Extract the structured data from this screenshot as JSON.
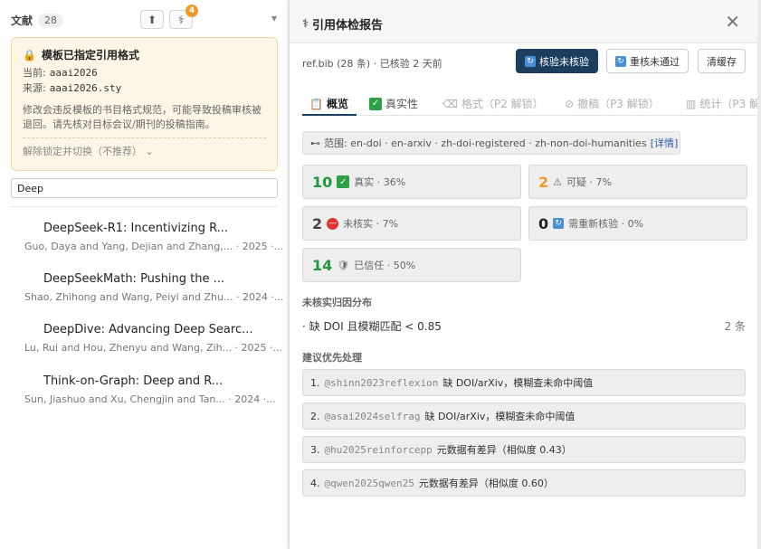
{
  "sidebar": {
    "title": "文献",
    "count": "28",
    "badge": "4",
    "lock_card": {
      "title": "模板已指定引用格式",
      "current_label": "当前:",
      "current_value": "aaai2026",
      "source_label": "来源:",
      "source_value": "aaai2026.sty",
      "description": "修改会违反模板的书目格式规范，可能导致投稿审核被退回。请先核对目标会议/期刊的投稿指南。",
      "unlock_label": "解除锁定并切换（不推荐）"
    },
    "search": {
      "value": "Deep"
    },
    "entries": [
      {
        "title": "DeepSeek-R1: Incentivizing R...",
        "meta": "Guo, Daya and Yang, Dejian and Zhang,... · 2025 ·..."
      },
      {
        "title": "DeepSeekMath: Pushing the ...",
        "meta": "Shao, Zhihong and Wang, Peiyi and Zhu... · 2024 ·..."
      },
      {
        "title": "DeepDive: Advancing Deep Searc...",
        "meta": "Lu, Rui and Hou, Zhenyu and Wang, Zih... · 2025 ·..."
      },
      {
        "title": "Think-on-Graph: Deep and R...",
        "meta": "Sun, Jiashuo and Xu, Chengjin and Tan... · 2024 ·..."
      }
    ]
  },
  "report": {
    "title": "引用体检报告",
    "file_info": "ref.bib (28 条) · 已核验 2 天前",
    "buttons": {
      "verify": "核验未核验",
      "recheck": "重核未通过",
      "clear": "清缓存"
    },
    "tabs": [
      {
        "label": "概览"
      },
      {
        "label": "真实性"
      },
      {
        "label": "格式（P2 解锁）"
      },
      {
        "label": "撤稿（P3 解锁）"
      },
      {
        "label": "统计（P3 解"
      }
    ],
    "scope": {
      "text": "范围: en-doi · en-arxiv · zh-doi-registered · zh-non-doi-humanities",
      "link": "[详情]"
    },
    "stats": [
      {
        "num": "10",
        "label": "真实 · 36%"
      },
      {
        "num": "2",
        "label": "可疑 · 7%"
      },
      {
        "num": "2",
        "label": "未核实 · 7%"
      },
      {
        "num": "0",
        "label": "需重新核验 · 0%"
      },
      {
        "num": "14",
        "label": "已信任 · 50%"
      }
    ],
    "unverified_title": "未核实归因分布",
    "reasons": [
      {
        "text": "· 缺 DOI 且模糊匹配 < 0.85",
        "count": "2 条"
      }
    ],
    "priority_title": "建议优先处理",
    "priorities": [
      {
        "index": "1.",
        "key": "@shinn2023reflexion",
        "text": "缺 DOI/arXiv，模糊查未命中阈值"
      },
      {
        "index": "2.",
        "key": "@asai2024selfrag",
        "text": "缺 DOI/arXiv，模糊查未命中阈值"
      },
      {
        "index": "3.",
        "key": "@hu2025reinforcepp",
        "text": "元数据有差异（相似度 0.43）"
      },
      {
        "index": "4.",
        "key": "@qwen2025qwen25",
        "text": "元数据有差异（相似度 0.60）"
      }
    ]
  }
}
